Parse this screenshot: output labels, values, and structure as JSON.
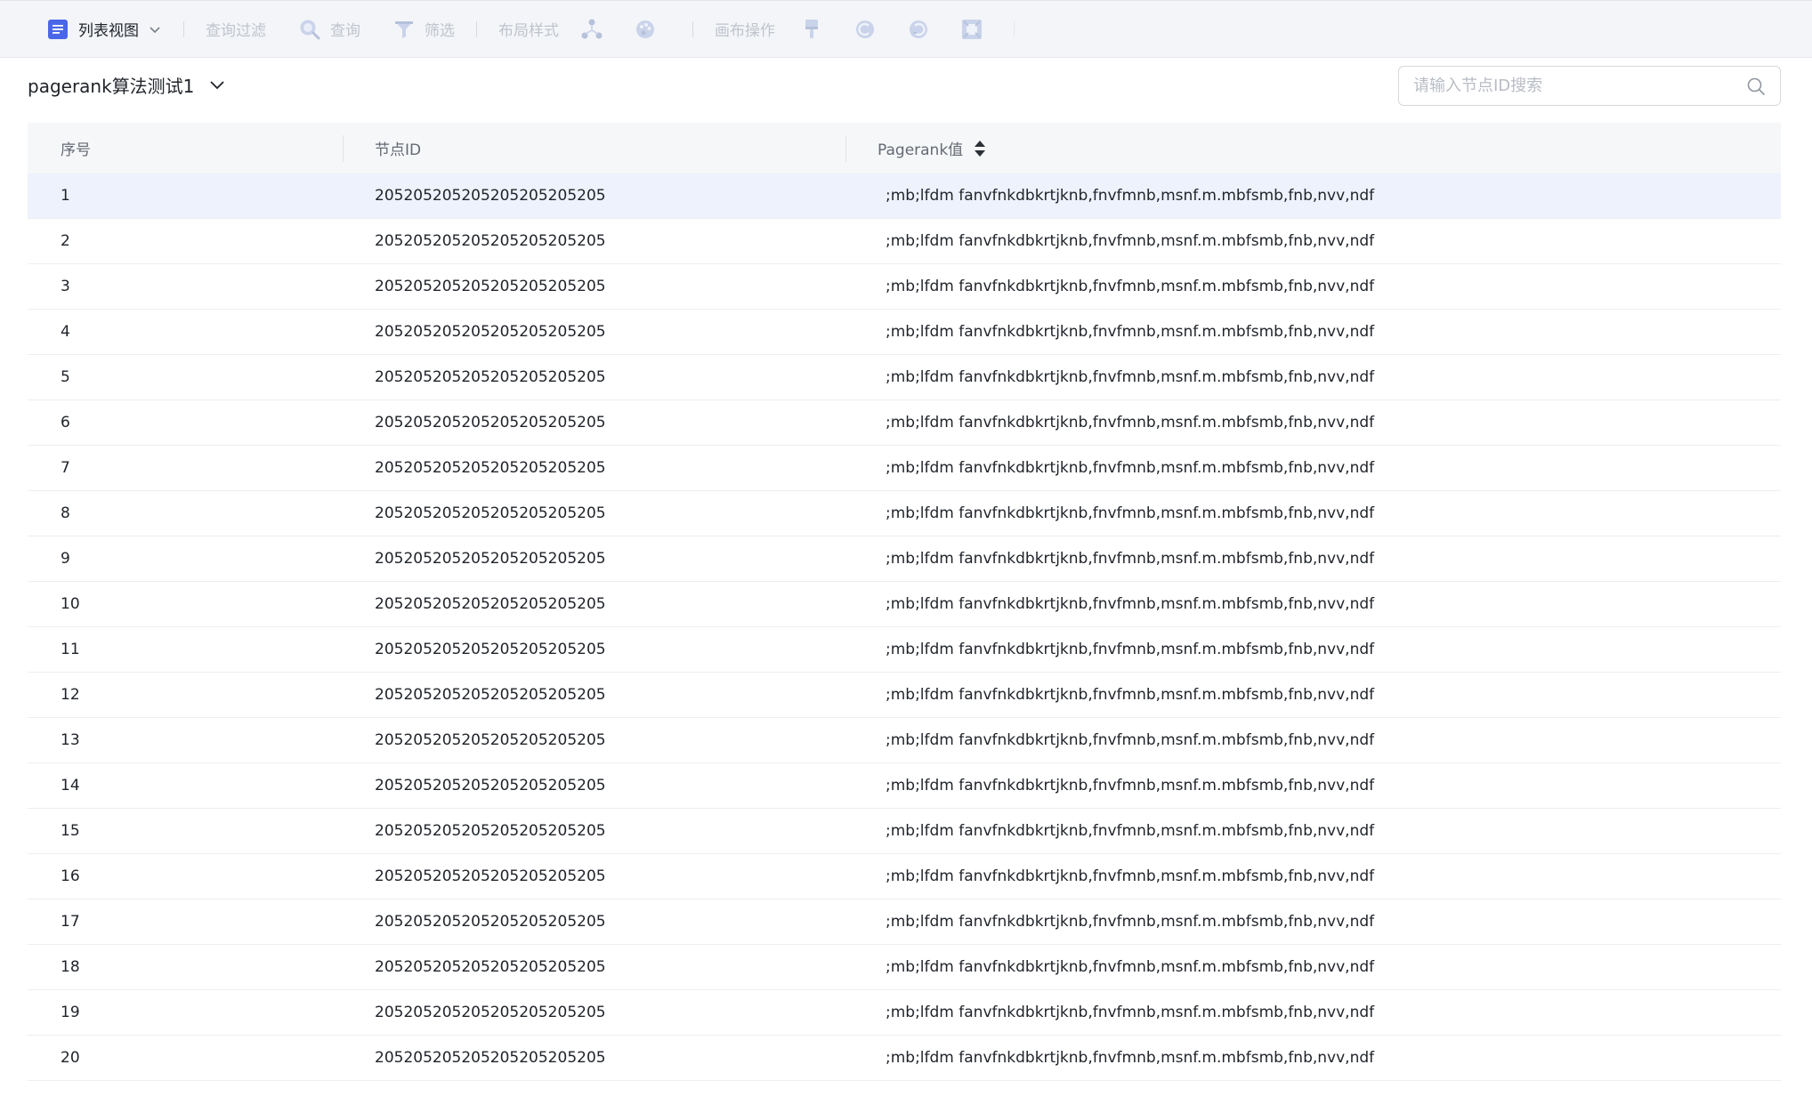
{
  "toolbar": {
    "view_label": "列表视图",
    "query_filter_label": "查询过滤",
    "query_label": "查询",
    "filter_label": "筛选",
    "layout_style_label": "布局样式",
    "canvas_ops_label": "画布操作"
  },
  "header": {
    "title": "pagerank算法测试1",
    "search_placeholder": "请输入节点ID搜索"
  },
  "table": {
    "columns": [
      "序号",
      "节点ID",
      "Pagerank值"
    ],
    "rows": [
      {
        "index": "1",
        "node_id": "205205205205205205205205",
        "value": ";mb;lfdm fanvfnkdbkrtjknb,fnvfmnb,msnf.m.mbfsmb,fnb,nvv,ndf"
      },
      {
        "index": "2",
        "node_id": "205205205205205205205205",
        "value": ";mb;lfdm fanvfnkdbkrtjknb,fnvfmnb,msnf.m.mbfsmb,fnb,nvv,ndf"
      },
      {
        "index": "3",
        "node_id": "205205205205205205205205",
        "value": ";mb;lfdm fanvfnkdbkrtjknb,fnvfmnb,msnf.m.mbfsmb,fnb,nvv,ndf"
      },
      {
        "index": "4",
        "node_id": "205205205205205205205205",
        "value": ";mb;lfdm fanvfnkdbkrtjknb,fnvfmnb,msnf.m.mbfsmb,fnb,nvv,ndf"
      },
      {
        "index": "5",
        "node_id": "205205205205205205205205",
        "value": ";mb;lfdm fanvfnkdbkrtjknb,fnvfmnb,msnf.m.mbfsmb,fnb,nvv,ndf"
      },
      {
        "index": "6",
        "node_id": "205205205205205205205205",
        "value": ";mb;lfdm fanvfnkdbkrtjknb,fnvfmnb,msnf.m.mbfsmb,fnb,nvv,ndf"
      },
      {
        "index": "7",
        "node_id": "205205205205205205205205",
        "value": ";mb;lfdm fanvfnkdbkrtjknb,fnvfmnb,msnf.m.mbfsmb,fnb,nvv,ndf"
      },
      {
        "index": "8",
        "node_id": "205205205205205205205205",
        "value": ";mb;lfdm fanvfnkdbkrtjknb,fnvfmnb,msnf.m.mbfsmb,fnb,nvv,ndf"
      },
      {
        "index": "9",
        "node_id": "205205205205205205205205",
        "value": ";mb;lfdm fanvfnkdbkrtjknb,fnvfmnb,msnf.m.mbfsmb,fnb,nvv,ndf"
      },
      {
        "index": "10",
        "node_id": "205205205205205205205205",
        "value": ";mb;lfdm fanvfnkdbkrtjknb,fnvfmnb,msnf.m.mbfsmb,fnb,nvv,ndf"
      },
      {
        "index": "11",
        "node_id": "205205205205205205205205",
        "value": ";mb;lfdm fanvfnkdbkrtjknb,fnvfmnb,msnf.m.mbfsmb,fnb,nvv,ndf"
      },
      {
        "index": "12",
        "node_id": "205205205205205205205205",
        "value": ";mb;lfdm fanvfnkdbkrtjknb,fnvfmnb,msnf.m.mbfsmb,fnb,nvv,ndf"
      },
      {
        "index": "13",
        "node_id": "205205205205205205205205",
        "value": ";mb;lfdm fanvfnkdbkrtjknb,fnvfmnb,msnf.m.mbfsmb,fnb,nvv,ndf"
      },
      {
        "index": "14",
        "node_id": "205205205205205205205205",
        "value": ";mb;lfdm fanvfnkdbkrtjknb,fnvfmnb,msnf.m.mbfsmb,fnb,nvv,ndf"
      },
      {
        "index": "15",
        "node_id": "205205205205205205205205",
        "value": ";mb;lfdm fanvfnkdbkrtjknb,fnvfmnb,msnf.m.mbfsmb,fnb,nvv,ndf"
      },
      {
        "index": "16",
        "node_id": "205205205205205205205205",
        "value": ";mb;lfdm fanvfnkdbkrtjknb,fnvfmnb,msnf.m.mbfsmb,fnb,nvv,ndf"
      },
      {
        "index": "17",
        "node_id": "205205205205205205205205",
        "value": ";mb;lfdm fanvfnkdbkrtjknb,fnvfmnb,msnf.m.mbfsmb,fnb,nvv,ndf"
      },
      {
        "index": "18",
        "node_id": "205205205205205205205205",
        "value": ";mb;lfdm fanvfnkdbkrtjknb,fnvfmnb,msnf.m.mbfsmb,fnb,nvv,ndf"
      },
      {
        "index": "19",
        "node_id": "205205205205205205205205",
        "value": ";mb;lfdm fanvfnkdbkrtjknb,fnvfmnb,msnf.m.mbfsmb,fnb,nvv,ndf"
      },
      {
        "index": "20",
        "node_id": "205205205205205205205205",
        "value": ";mb;lfdm fanvfnkdbkrtjknb,fnvfmnb,msnf.m.mbfsmb,fnb,nvv,ndf"
      }
    ]
  },
  "colors": {
    "accent": "#4a66e8",
    "toolbar_bg": "#f3f5f8",
    "highlight_row": "#edf2fc",
    "disabled_text": "#c0c4cc"
  }
}
